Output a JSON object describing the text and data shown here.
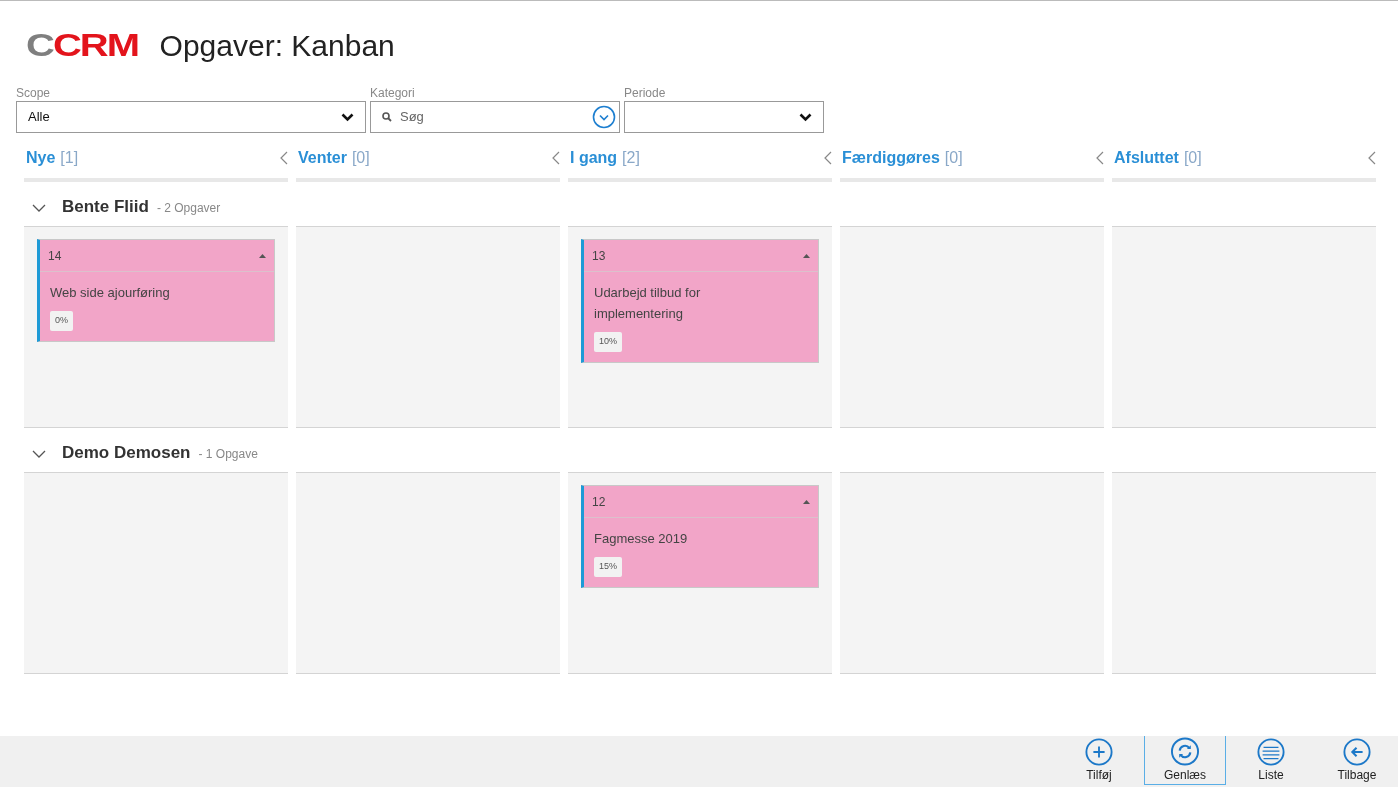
{
  "header": {
    "logo": "CCRM",
    "title": "Opgaver: Kanban"
  },
  "filters": [
    {
      "kind": "select",
      "label": "Scope",
      "value": "Alle"
    },
    {
      "kind": "search",
      "label": "Kategori",
      "placeholder": "Søg"
    },
    {
      "kind": "select",
      "label": "Periode"
    }
  ],
  "columns": [
    {
      "title": "Nye",
      "count": "[1]"
    },
    {
      "title": "Venter",
      "count": "[0]"
    },
    {
      "title": "I gang",
      "count": "[2]"
    },
    {
      "title": "Færdiggøres",
      "count": "[0]"
    },
    {
      "title": "Afsluttet",
      "count": "[0]"
    }
  ],
  "lanes": [
    {
      "name": "Bente Fliid",
      "summary": "- 2 Opgaver",
      "expanded": true,
      "cells": [
        [
          {
            "id": "14",
            "title": "Web side ajourføring",
            "progress": "0%"
          }
        ],
        [],
        [
          {
            "id": "13",
            "title": "Udarbejd tilbud for implementering",
            "progress": "10%"
          }
        ],
        [],
        []
      ]
    },
    {
      "name": "Demo Demosen",
      "summary": "- 1 Opgave",
      "expanded": true,
      "cells": [
        [],
        [],
        [
          {
            "id": "12",
            "title": "Fagmesse 2019",
            "progress": "15%"
          }
        ],
        [],
        []
      ]
    }
  ],
  "toolbar": [
    {
      "kind": "add",
      "label": "Tilføj",
      "selected": false
    },
    {
      "kind": "refresh",
      "label": "Genlæs",
      "selected": true
    },
    {
      "kind": "list",
      "label": "Liste",
      "selected": false
    },
    {
      "kind": "back",
      "label": "Tilbage",
      "selected": false
    }
  ]
}
